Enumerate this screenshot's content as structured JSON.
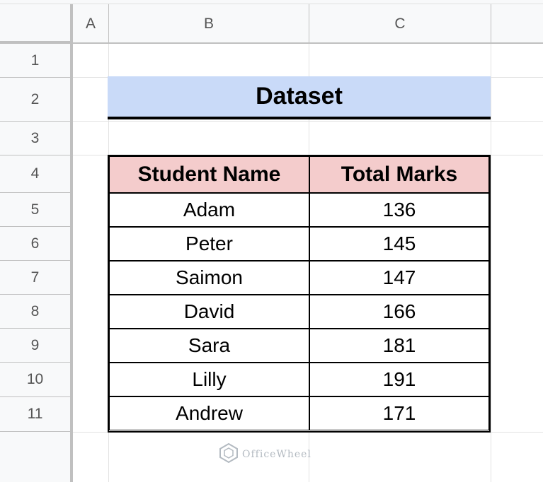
{
  "columns": [
    "A",
    "B",
    "C"
  ],
  "rows": [
    "1",
    "2",
    "3",
    "4",
    "5",
    "6",
    "7",
    "8",
    "9",
    "10",
    "11"
  ],
  "title": "Dataset",
  "table": {
    "headers": [
      "Student Name",
      "Total Marks"
    ],
    "rows": [
      [
        "Adam",
        "136"
      ],
      [
        "Peter",
        "145"
      ],
      [
        "Saimon",
        "147"
      ],
      [
        "David",
        "166"
      ],
      [
        "Sara",
        "181"
      ],
      [
        "Lilly",
        "191"
      ],
      [
        "Andrew",
        "171"
      ]
    ]
  },
  "watermark": "OfficeWheel",
  "colors": {
    "title_fill": "#c9daf8",
    "header_fill": "#f4cccc",
    "header_strip": "#f8f9fa"
  }
}
